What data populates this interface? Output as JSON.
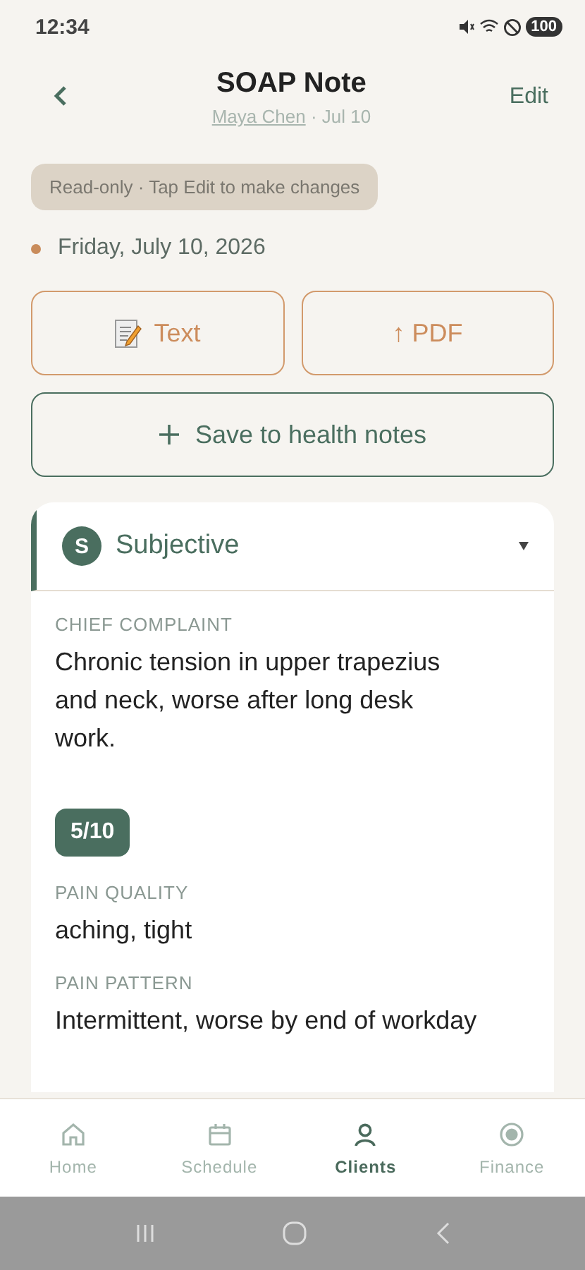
{
  "status_bar": {
    "time": "12:34",
    "battery": "100"
  },
  "header": {
    "title": "SOAP Note",
    "client": "Maya Chen",
    "date": " · Jul 10",
    "edit": "Edit"
  },
  "banner": "Read-only · Tap Edit to make changes",
  "session_date": "Friday, July 10, 2026",
  "actions": [
    {
      "kind": "text",
      "label": "Text"
    },
    {
      "kind": "pdf",
      "label": "↑ PDF"
    }
  ],
  "save_button": "Save to health notes",
  "section": {
    "letter": "S",
    "title": "Subjective",
    "expanded": true,
    "fields": [
      {
        "kind": "text",
        "label": "CHIEF COMPLAINT",
        "value": "Chronic tension in upper trapezius and neck, worse after long desk work."
      },
      {
        "kind": "pill",
        "value": "5/10"
      },
      {
        "kind": "text",
        "label": "PAIN QUALITY",
        "value": "aching, tight"
      },
      {
        "kind": "text",
        "label": "PAIN PATTERN",
        "value": "Intermittent, worse by end of workday"
      }
    ]
  },
  "nav": [
    {
      "kind": "home",
      "label": "Home",
      "selected": false
    },
    {
      "kind": "calendar",
      "label": "Schedule",
      "selected": false
    },
    {
      "kind": "person",
      "label": "Clients",
      "selected": true
    },
    {
      "kind": "finance",
      "label": "Finance",
      "selected": false
    }
  ]
}
